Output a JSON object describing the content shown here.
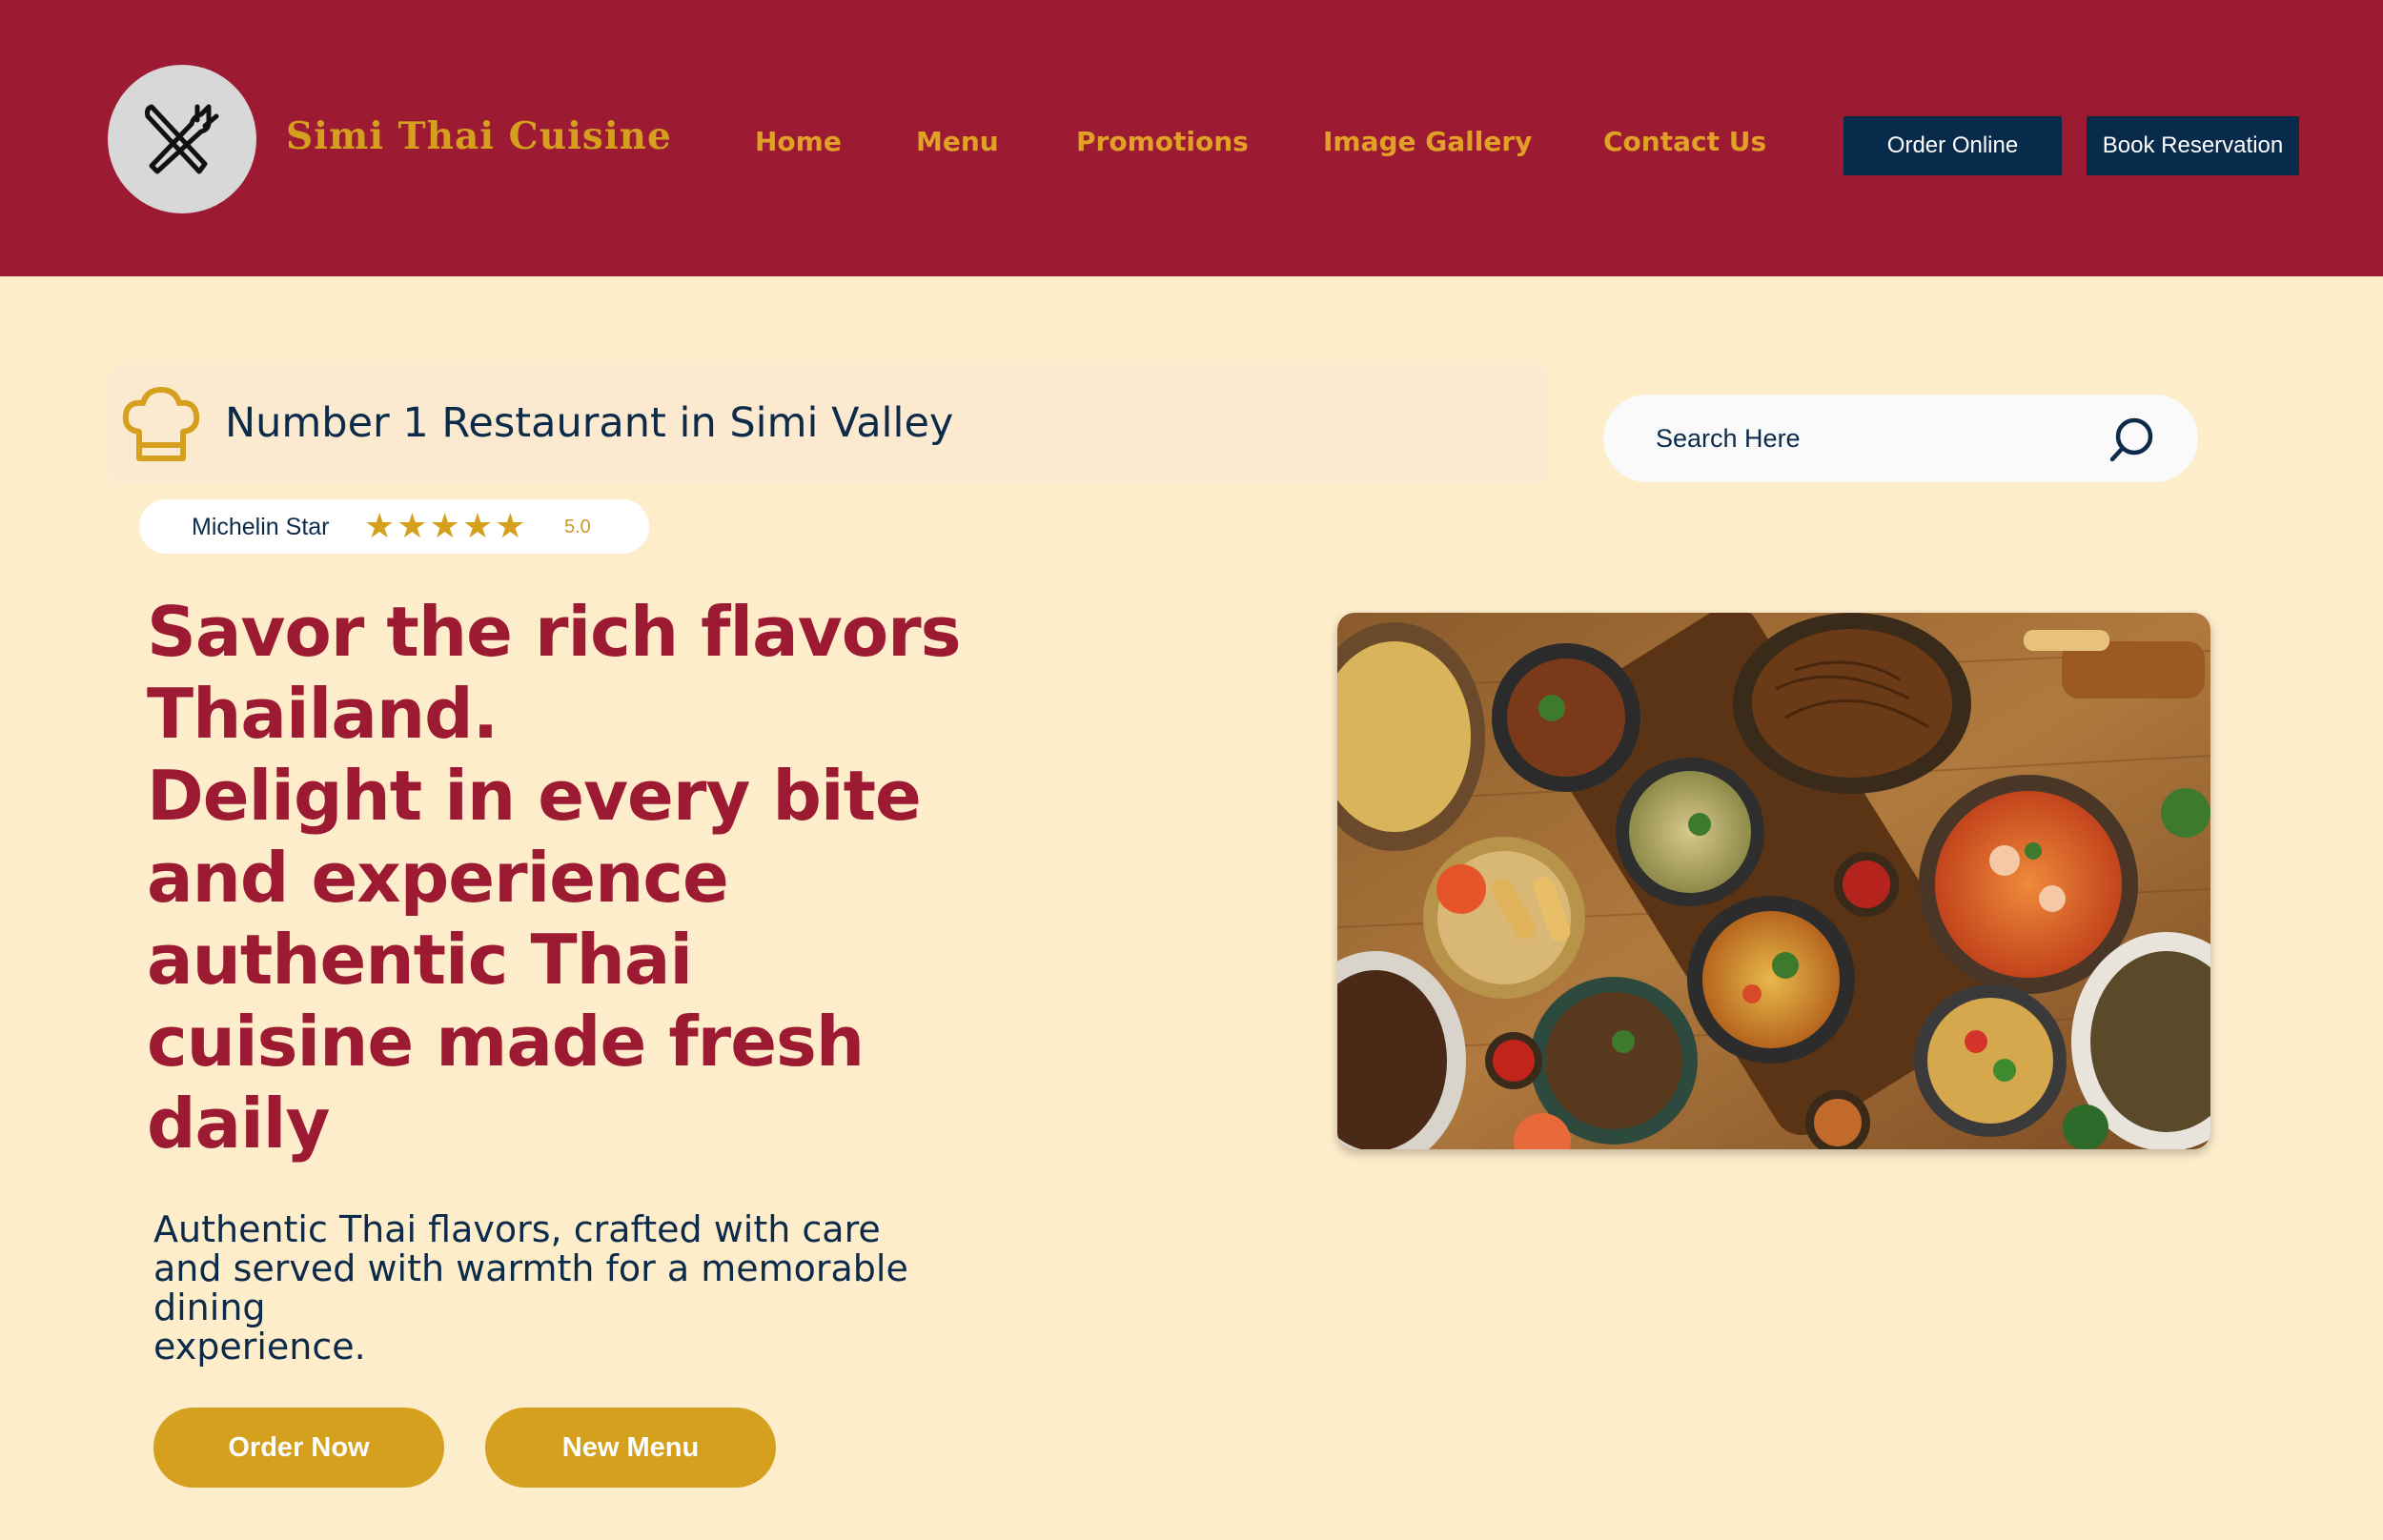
{
  "header": {
    "brand": "Simi Thai Cuisine",
    "nav": [
      "Home",
      "Menu",
      "Promotions",
      "Image Gallery",
      "Contact Us"
    ],
    "order_online": "Order Online",
    "book_reservation": "Book Reservation"
  },
  "badge": {
    "text": "Number 1 Restaurant in Simi Valley",
    "icon": "chef-hat-icon"
  },
  "search": {
    "placeholder": "Search Here",
    "value": ""
  },
  "rating": {
    "label": "Michelin Star",
    "stars": 5,
    "value": "5.0"
  },
  "hero": {
    "headline": [
      "Savor the rich flavors",
      "Thailand.",
      "Delight in every bite",
      "and experience",
      "authentic Thai",
      "cuisine made fresh",
      "daily"
    ],
    "subtext": [
      "Authentic Thai flavors, crafted with care",
      "and served with warmth for a memorable",
      "dining",
      "experience."
    ],
    "order_now": "Order Now",
    "new_menu": "New Menu"
  },
  "colors": {
    "header_bg": "#9D1B32",
    "page_bg": "#FEEDCB",
    "accent_gold": "#D4A01E",
    "navy": "#082A4B"
  },
  "image": {
    "alt": "Overhead spread of Thai dishes"
  }
}
